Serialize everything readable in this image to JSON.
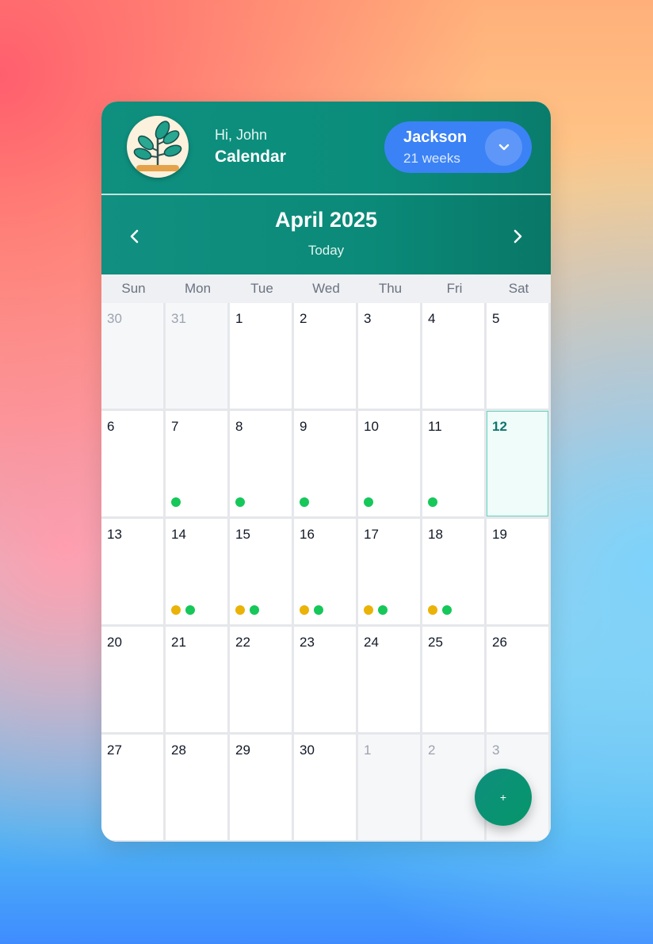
{
  "header": {
    "greeting": "Hi, John",
    "title": "Calendar",
    "avatar_icon": "plant-icon",
    "profile": {
      "name": "Jackson",
      "subtitle": "21 weeks"
    }
  },
  "calendar": {
    "month_label": "April 2025",
    "today_label": "Today",
    "weekdays": [
      "Sun",
      "Mon",
      "Tue",
      "Wed",
      "Thu",
      "Fri",
      "Sat"
    ],
    "weeks": [
      [
        {
          "day": "30",
          "out": true,
          "dots": []
        },
        {
          "day": "31",
          "out": true,
          "dots": []
        },
        {
          "day": "1",
          "dots": []
        },
        {
          "day": "2",
          "dots": []
        },
        {
          "day": "3",
          "dots": []
        },
        {
          "day": "4",
          "dots": []
        },
        {
          "day": "5",
          "dots": []
        }
      ],
      [
        {
          "day": "6",
          "dots": []
        },
        {
          "day": "7",
          "dots": [
            "green"
          ]
        },
        {
          "day": "8",
          "dots": [
            "green"
          ]
        },
        {
          "day": "9",
          "dots": [
            "green"
          ]
        },
        {
          "day": "10",
          "dots": [
            "green"
          ]
        },
        {
          "day": "11",
          "dots": [
            "green"
          ]
        },
        {
          "day": "12",
          "today": true,
          "dots": []
        }
      ],
      [
        {
          "day": "13",
          "dots": []
        },
        {
          "day": "14",
          "dots": [
            "amber",
            "green"
          ]
        },
        {
          "day": "15",
          "dots": [
            "amber",
            "green"
          ]
        },
        {
          "day": "16",
          "dots": [
            "amber",
            "green"
          ]
        },
        {
          "day": "17",
          "dots": [
            "amber",
            "green"
          ]
        },
        {
          "day": "18",
          "dots": [
            "amber",
            "green"
          ]
        },
        {
          "day": "19",
          "dots": []
        }
      ],
      [
        {
          "day": "20",
          "dots": []
        },
        {
          "day": "21",
          "dots": []
        },
        {
          "day": "22",
          "dots": []
        },
        {
          "day": "23",
          "dots": []
        },
        {
          "day": "24",
          "dots": []
        },
        {
          "day": "25",
          "dots": []
        },
        {
          "day": "26",
          "dots": []
        }
      ],
      [
        {
          "day": "27",
          "dots": []
        },
        {
          "day": "28",
          "dots": []
        },
        {
          "day": "29",
          "dots": []
        },
        {
          "day": "30",
          "dots": []
        },
        {
          "day": "1",
          "out": true,
          "dots": []
        },
        {
          "day": "2",
          "out": true,
          "dots": []
        },
        {
          "day": "3",
          "out": true,
          "dots": []
        }
      ]
    ]
  },
  "fab": {
    "label": "+"
  },
  "colors": {
    "primary": "#0f8f7e",
    "accent_blue": "#3b82f6",
    "dot_green": "#16c75a",
    "dot_amber": "#eab308"
  }
}
